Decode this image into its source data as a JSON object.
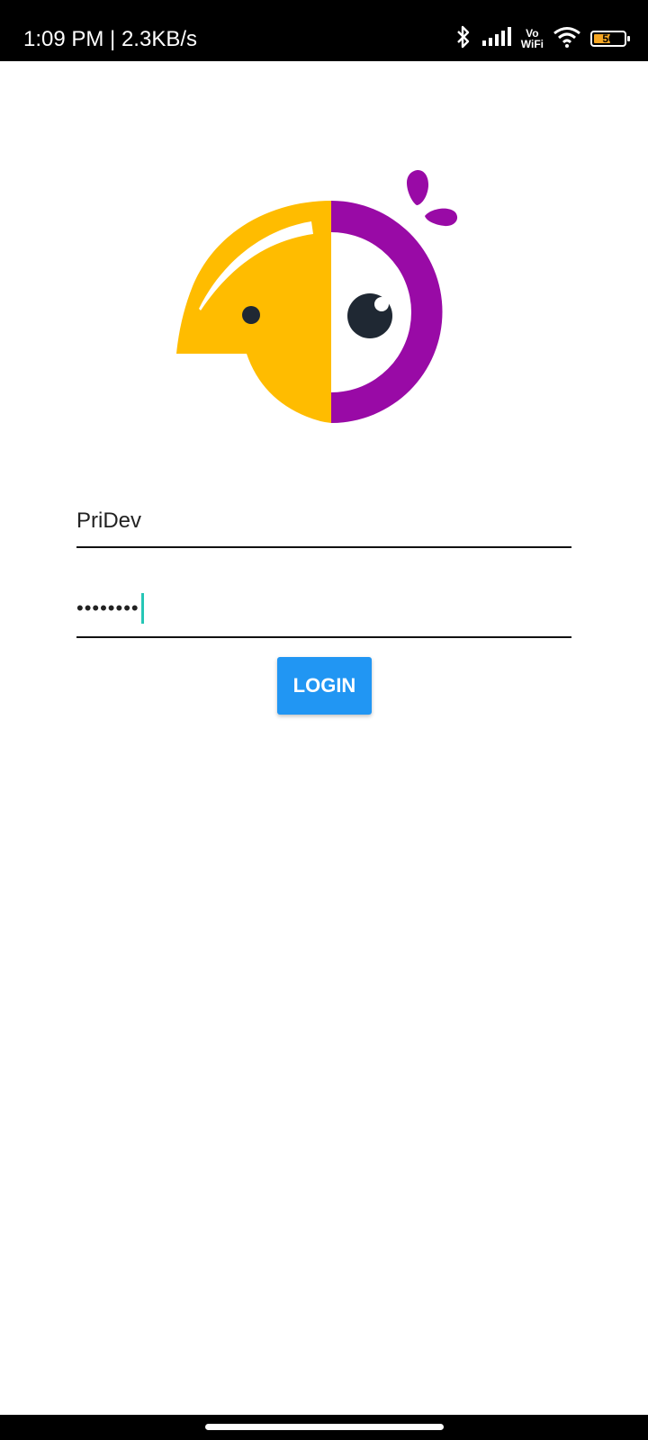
{
  "status_bar": {
    "time_speed": "1:09 PM | 2.3KB/s",
    "vowifi_top": "Vo",
    "vowifi_bottom": "WiFi",
    "battery_level": "56",
    "icons": [
      "bluetooth-icon",
      "signal-icon",
      "vowifi-icon",
      "wifi-icon",
      "battery-icon"
    ]
  },
  "logo": {
    "name": "parrot-logo",
    "colors": {
      "yellow": "#FFBC00",
      "purple": "#990AA6",
      "eye": "#1F2833"
    }
  },
  "login_form": {
    "username_value": "PriDev",
    "password_value": "••••••••",
    "login_label": "LOGIN"
  },
  "colors": {
    "accent": "#2196F3",
    "cursor": "#26C6B6"
  }
}
